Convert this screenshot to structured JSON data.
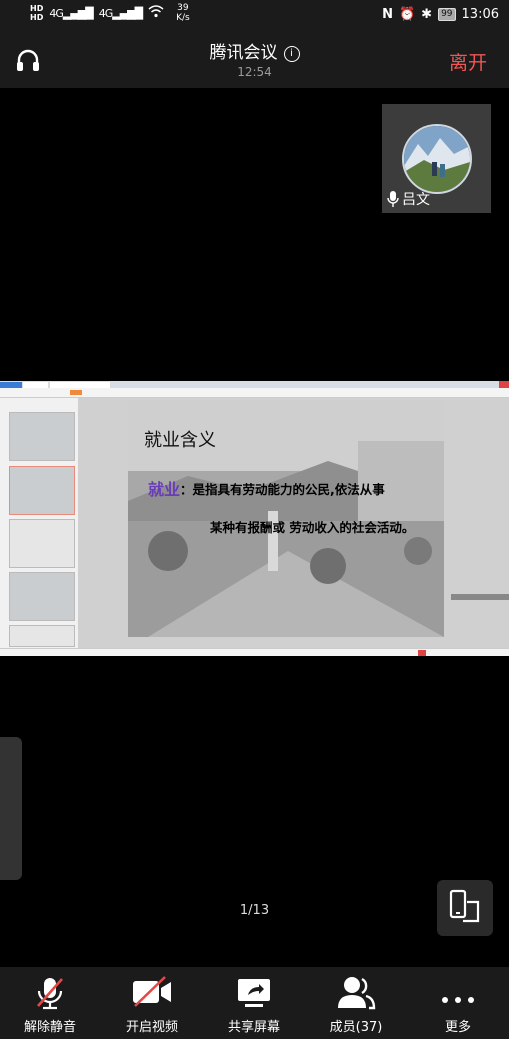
{
  "status": {
    "hd1": "HD",
    "hd2": "HD",
    "net1": "4G",
    "net2": "4G",
    "speed_value": "39",
    "speed_unit": "K/s",
    "battery": "99",
    "clock": "13:06"
  },
  "header": {
    "title": "腾讯会议",
    "time": "12:54",
    "leave": "离开"
  },
  "tile": {
    "name": "吕文"
  },
  "slide": {
    "title": "就业含义",
    "keyword": "就业",
    "line1": "：是指具有劳动能力的公民,依法从事",
    "line2": "某种有报酬或 劳动收入的社会活动。"
  },
  "pager": "1/13",
  "toolbar": {
    "mute": "解除静音",
    "video": "开启视频",
    "share": "共享屏幕",
    "members": "成员(37)",
    "more": "更多"
  },
  "colors": {
    "leave": "#f15656",
    "keyword": "#6a3db8",
    "toolbar_bg": "#1b1b1b"
  }
}
